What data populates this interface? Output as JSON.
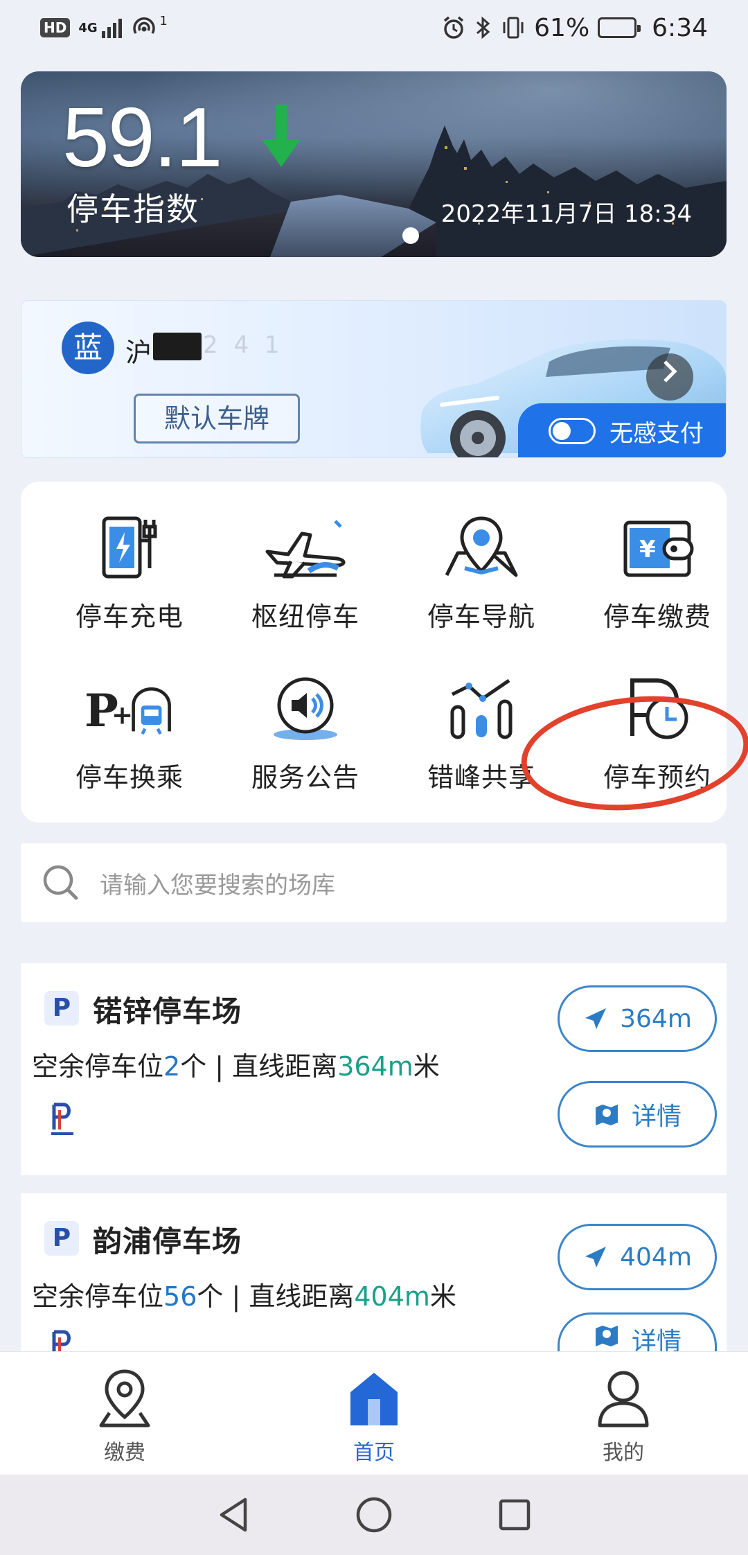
{
  "status_bar": {
    "hd": "HD",
    "network": "4G",
    "hotspot_count": "1",
    "battery": "61%",
    "time": "6:34"
  },
  "banner": {
    "index_value": "59.1",
    "index_trend": "down",
    "index_label": "停车指数",
    "datetime": "2022年11月7日 18:34"
  },
  "plate": {
    "color_badge": "蓝",
    "prefix": "沪",
    "masked_suffix": "2 4 1",
    "default_button": "默认车牌",
    "seamless_pay_label": "无感支付",
    "seamless_pay_enabled": false
  },
  "services": [
    {
      "label": "停车充电",
      "icon": "charging-station-icon"
    },
    {
      "label": "枢纽停车",
      "icon": "airplane-icon"
    },
    {
      "label": "停车导航",
      "icon": "map-pin-icon"
    },
    {
      "label": "停车缴费",
      "icon": "wallet-icon"
    },
    {
      "label": "停车换乘",
      "icon": "park-and-ride-icon"
    },
    {
      "label": "服务公告",
      "icon": "speaker-icon"
    },
    {
      "label": "错峰共享",
      "icon": "share-chart-icon"
    },
    {
      "label": "停车预约",
      "icon": "parking-clock-icon"
    }
  ],
  "search": {
    "placeholder": "请输入您要搜索的场库"
  },
  "lots": [
    {
      "name": "锘锌停车场",
      "spaces_prefix": "空余停车位",
      "spaces": "2",
      "spaces_unit": "个",
      "distance_prefix": " | 直线距离",
      "distance": "364m",
      "distance_unit": "米",
      "nav_button": "364m",
      "detail_button": "详情"
    },
    {
      "name": "韵浦停车场",
      "spaces_prefix": "空余停车位",
      "spaces": "56",
      "spaces_unit": "个",
      "distance_prefix": " | 直线距离",
      "distance": "404m",
      "distance_unit": "米",
      "nav_button": "404m",
      "detail_button": "详情"
    }
  ],
  "bottom_nav": [
    {
      "label": "缴费",
      "active": false
    },
    {
      "label": "首页",
      "active": true
    },
    {
      "label": "我的",
      "active": false
    }
  ],
  "colors": {
    "accent_blue": "#1f72e8",
    "active_tab": "#2467d6",
    "distance_green": "#1aa089",
    "highlight_red": "#e2412b",
    "trend_green": "#22b14c"
  }
}
